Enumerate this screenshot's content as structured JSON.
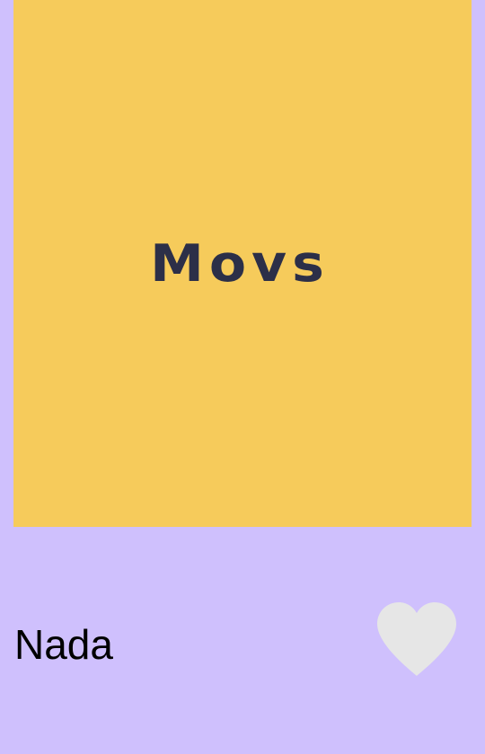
{
  "movie": {
    "poster_text": "Movs",
    "title": "Nada",
    "favorite": false
  },
  "colors": {
    "background": "#CFC0FD",
    "poster_background": "#F6CB5B",
    "poster_text": "#2C2F48",
    "title_text": "#000000",
    "heart_fill": "#E6E6E6"
  },
  "icons": {
    "favorite": "heart-icon"
  }
}
